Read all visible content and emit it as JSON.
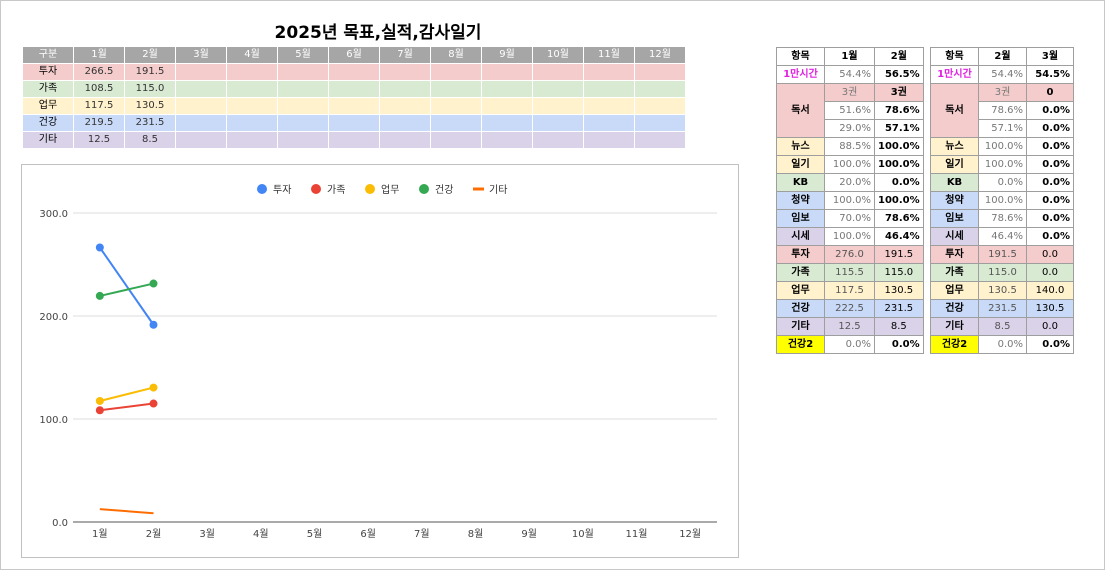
{
  "title": "2025년 목표,실적,감사일기",
  "main_table": {
    "header": [
      "구분",
      "1월",
      "2월",
      "3월",
      "4월",
      "5월",
      "6월",
      "7월",
      "8월",
      "9월",
      "10월",
      "11월",
      "12월"
    ],
    "rows": [
      {
        "label": "투자",
        "values": [
          "266.5",
          "191.5",
          "",
          "",
          "",
          "",
          "",
          "",
          "",
          "",
          "",
          ""
        ],
        "color": "#f4cccc"
      },
      {
        "label": "가족",
        "values": [
          "108.5",
          "115.0",
          "",
          "",
          "",
          "",
          "",
          "",
          "",
          "",
          "",
          ""
        ],
        "color": "#d9ead3"
      },
      {
        "label": "업무",
        "values": [
          "117.5",
          "130.5",
          "",
          "",
          "",
          "",
          "",
          "",
          "",
          "",
          "",
          ""
        ],
        "color": "#fff2cc"
      },
      {
        "label": "건강",
        "values": [
          "219.5",
          "231.5",
          "",
          "",
          "",
          "",
          "",
          "",
          "",
          "",
          "",
          ""
        ],
        "color": "#c9daf8"
      },
      {
        "label": "기타",
        "values": [
          "12.5",
          "8.5",
          "",
          "",
          "",
          "",
          "",
          "",
          "",
          "",
          "",
          ""
        ],
        "color": "#d9d2e9"
      }
    ]
  },
  "chart_data": {
    "type": "line",
    "categories": [
      "1월",
      "2월",
      "3월",
      "4월",
      "5월",
      "6월",
      "7월",
      "8월",
      "9월",
      "10월",
      "11월",
      "12월"
    ],
    "series": [
      {
        "name": "투자",
        "values": [
          266.5,
          191.5
        ],
        "color": "#4285f4",
        "marker": "dot"
      },
      {
        "name": "가족",
        "values": [
          108.5,
          115.0
        ],
        "color": "#ea4335",
        "marker": "dot"
      },
      {
        "name": "업무",
        "values": [
          117.5,
          130.5
        ],
        "color": "#fbbc04",
        "marker": "dot"
      },
      {
        "name": "건강",
        "values": [
          219.5,
          231.5
        ],
        "color": "#34a853",
        "marker": "dot"
      },
      {
        "name": "기타",
        "values": [
          12.5,
          8.5
        ],
        "color": "#ff6d01",
        "marker": "line"
      }
    ],
    "ylim": [
      0,
      300
    ],
    "yticks": [
      0,
      100,
      200,
      300
    ],
    "ytick_labels": [
      "0.0",
      "100.0",
      "200.0",
      "300.0"
    ],
    "grid": true,
    "legend": "top-center"
  },
  "side_table_1": {
    "header": [
      "항목",
      "1월",
      "2월"
    ],
    "rows": [
      {
        "label": "1만시간",
        "a": "54.4%",
        "b": "56.5%",
        "color": "#ffffff",
        "label_class": "mag",
        "kind": "pct"
      },
      {
        "label": "독서",
        "a": "3권",
        "b": "3권",
        "color": "#f4cccc",
        "kind": "cnt",
        "span": 3
      },
      {
        "label": "",
        "a": "51.6%",
        "b": "78.6%",
        "color": "#f4cccc",
        "kind": "pct",
        "cont": true
      },
      {
        "label": "",
        "a": "29.0%",
        "b": "57.1%",
        "color": "#f4cccc",
        "kind": "pct",
        "cont": true
      },
      {
        "label": "뉴스",
        "a": "88.5%",
        "b": "100.0%",
        "color": "#fff2cc",
        "kind": "pct"
      },
      {
        "label": "일기",
        "a": "100.0%",
        "b": "100.0%",
        "color": "#fff2cc",
        "kind": "pct"
      },
      {
        "label": "KB",
        "a": "20.0%",
        "b": "0.0%",
        "color": "#d9ead3",
        "kind": "pct"
      },
      {
        "label": "청약",
        "a": "100.0%",
        "b": "100.0%",
        "color": "#c9daf8",
        "kind": "pct"
      },
      {
        "label": "임보",
        "a": "70.0%",
        "b": "78.6%",
        "color": "#c9daf8",
        "kind": "pct"
      },
      {
        "label": "시세",
        "a": "100.0%",
        "b": "46.4%",
        "color": "#d9d2e9",
        "kind": "pct"
      },
      {
        "label": "투자",
        "a": "276.0",
        "b": "191.5",
        "color": "#f4cccc",
        "kind": "num"
      },
      {
        "label": "가족",
        "a": "115.5",
        "b": "115.0",
        "color": "#d9ead3",
        "kind": "num"
      },
      {
        "label": "업무",
        "a": "117.5",
        "b": "130.5",
        "color": "#fff2cc",
        "kind": "num"
      },
      {
        "label": "건강",
        "a": "222.5",
        "b": "231.5",
        "color": "#c9daf8",
        "kind": "num"
      },
      {
        "label": "기타",
        "a": "12.5",
        "b": "8.5",
        "color": "#d9d2e9",
        "kind": "num"
      },
      {
        "label": "건강2",
        "a": "0.0%",
        "b": "0.0%",
        "color": "#ffff00",
        "kind": "pct"
      }
    ]
  },
  "side_table_2": {
    "header": [
      "항목",
      "2월",
      "3월"
    ],
    "rows": [
      {
        "label": "1만시간",
        "a": "54.4%",
        "b": "54.5%",
        "color": "#ffffff",
        "label_class": "mag",
        "kind": "pct"
      },
      {
        "label": "독서",
        "a": "3권",
        "b": "0",
        "color": "#f4cccc",
        "kind": "cnt",
        "span": 3
      },
      {
        "label": "",
        "a": "78.6%",
        "b": "0.0%",
        "color": "#f4cccc",
        "kind": "pct",
        "cont": true
      },
      {
        "label": "",
        "a": "57.1%",
        "b": "0.0%",
        "color": "#f4cccc",
        "kind": "pct",
        "cont": true
      },
      {
        "label": "뉴스",
        "a": "100.0%",
        "b": "0.0%",
        "color": "#fff2cc",
        "kind": "pct"
      },
      {
        "label": "일기",
        "a": "100.0%",
        "b": "0.0%",
        "color": "#fff2cc",
        "kind": "pct"
      },
      {
        "label": "KB",
        "a": "0.0%",
        "b": "0.0%",
        "color": "#d9ead3",
        "kind": "pct"
      },
      {
        "label": "청약",
        "a": "100.0%",
        "b": "0.0%",
        "color": "#c9daf8",
        "kind": "pct"
      },
      {
        "label": "임보",
        "a": "78.6%",
        "b": "0.0%",
        "color": "#c9daf8",
        "kind": "pct"
      },
      {
        "label": "시세",
        "a": "46.4%",
        "b": "0.0%",
        "color": "#d9d2e9",
        "kind": "pct"
      },
      {
        "label": "투자",
        "a": "191.5",
        "b": "0.0",
        "color": "#f4cccc",
        "kind": "num"
      },
      {
        "label": "가족",
        "a": "115.0",
        "b": "0.0",
        "color": "#d9ead3",
        "kind": "num"
      },
      {
        "label": "업무",
        "a": "130.5",
        "b": "140.0",
        "color": "#fff2cc",
        "kind": "num"
      },
      {
        "label": "건강",
        "a": "231.5",
        "b": "130.5",
        "color": "#c9daf8",
        "kind": "num"
      },
      {
        "label": "기타",
        "a": "8.5",
        "b": "0.0",
        "color": "#d9d2e9",
        "kind": "num"
      },
      {
        "label": "건강2",
        "a": "0.0%",
        "b": "0.0%",
        "color": "#ffff00",
        "kind": "pct"
      }
    ]
  }
}
